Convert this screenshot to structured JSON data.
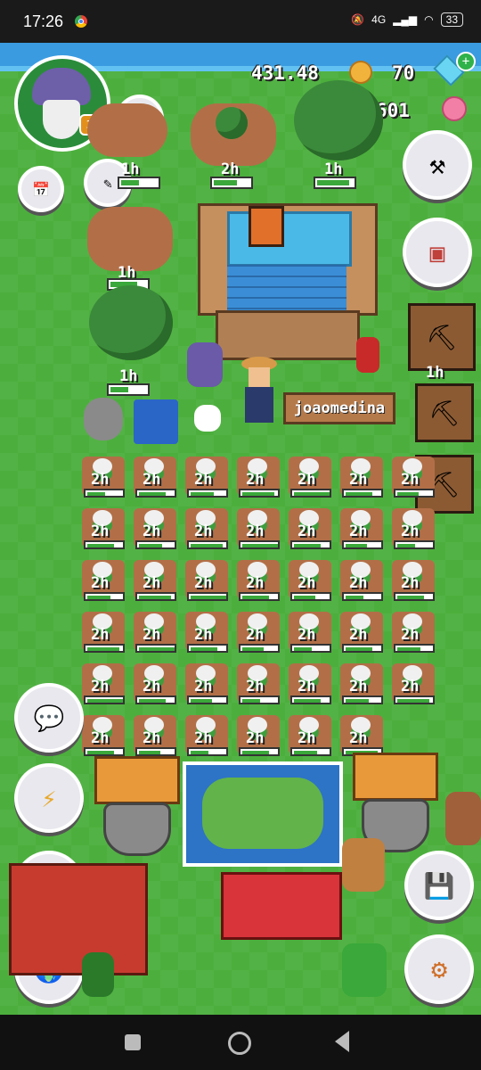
{
  "status_bar": {
    "time": "17:26",
    "network": "4G",
    "battery": "33"
  },
  "resources": {
    "coins": "431.48",
    "gems": "70",
    "flowers": "4.4601"
  },
  "player": {
    "level": "34",
    "name_sign": "joaomedina"
  },
  "plot_timers": {
    "upper": [
      "1h",
      "2h",
      "1h",
      "1h",
      "1h"
    ],
    "pickaxe_timer": "1h"
  },
  "crop_grid": {
    "rows": [
      [
        "2h",
        "2h",
        "2h",
        "2h",
        "2h",
        "2h",
        "2h"
      ],
      [
        "2h",
        "2h",
        "2h",
        "2h",
        "2h",
        "2h",
        "2h"
      ],
      [
        "2h",
        "2h",
        "2h",
        "2h",
        "2h",
        "2h",
        "2h"
      ],
      [
        "2h",
        "2h",
        "2h",
        "2h",
        "2h",
        "2h",
        "2h"
      ],
      [
        "2h",
        "2h",
        "2h",
        "2h",
        "2h",
        "2h",
        "2h"
      ],
      [
        "2h",
        "2h",
        "2h",
        "2h",
        "2h",
        "2h"
      ]
    ]
  },
  "icons": {
    "left": [
      "avatar",
      "calendar-icon",
      "pencil-icon",
      "chat-icon",
      "lightning-icon",
      "trade-icon",
      "globe-icon"
    ],
    "right": [
      "hammer-icon",
      "toolbox-icon",
      "rake-icon",
      "pickaxe-icon",
      "pickaxe-icon",
      "save-icon",
      "gear-icon"
    ]
  },
  "colors": {
    "grass": "#4caf3d",
    "soil": "#b26f47",
    "water": "#3a9be0",
    "progress": "#3aa83a"
  }
}
